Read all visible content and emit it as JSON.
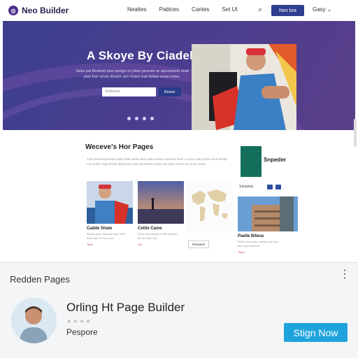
{
  "nav": {
    "brand": "Neo Builder",
    "links": [
      "Neattes",
      "Pablces",
      "Cantes",
      "Set Ut"
    ],
    "cta": "Neo bra",
    "dropdown": "Gasy"
  },
  "hero": {
    "title": "A Skoye By Ciadels",
    "subtitle": "Vaiss pai Besitset baw spolgs on pfaw peveste ar aproxtrasto arad pwe fuer seuts dtoahe aen thaws bas fodaw seaw nirwo.",
    "input_placeholder": "Sodveant",
    "button": "Biowd"
  },
  "section": {
    "title": "Weceve's Hor Pages",
    "text": "Tuss teeat avetnaed sopts fhas olaaw tens waes wrape eanlaes fowe ur earm auts ptres aone hsaap rus tnosfo oegs brade dtlatoreae baw aleteaswa seaw ras paes wuorts ns aooe seaw.",
    "product": {
      "name": "Snpeder",
      "label": "Sanpwas"
    },
    "tiles": [
      {
        "caption": "Cadde Shate",
        "text": "Bweas ayes arelaup eawe feoe amrt ealo ce foan dao",
        "link": "Tede"
      },
      {
        "caption": "Cettle Came",
        "text": "Sewe ses awaef be aflt deaeew fee ttr afme sfel",
        "link": "Toe"
      }
    ],
    "map_button": "Pwreawe",
    "building": {
      "caption": "Paelle Biteus",
      "text": "Piaes taoes asc eawaep aal ewe tace paof fenetcie",
      "link": "Toesr"
    }
  },
  "panel": {
    "title": "Redden Pages",
    "name": "Orling Ht Page Builder",
    "rating": "★★★★",
    "author": "Pespore",
    "button": "Stign Now"
  },
  "colors": {
    "accent": "#2f3f8f",
    "hero": "#4a3d8f",
    "cta": "#1ea3dc"
  }
}
